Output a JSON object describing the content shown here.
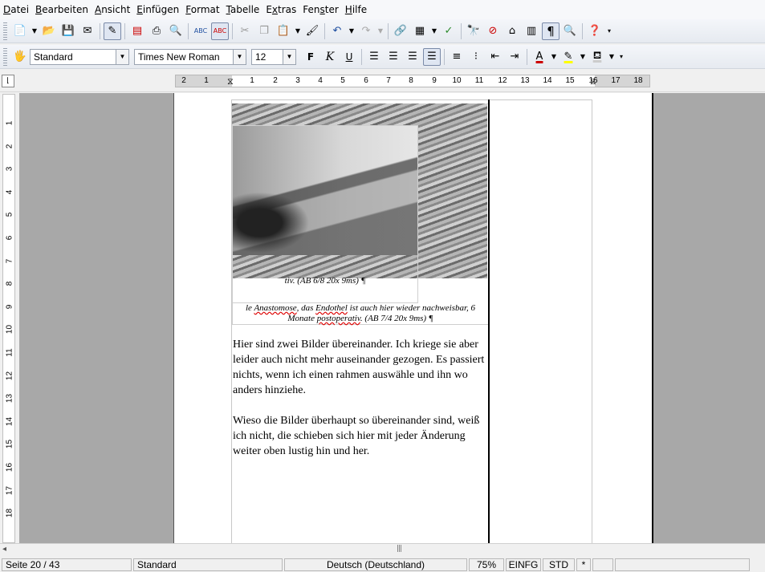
{
  "menubar": {
    "items": [
      {
        "pre": "",
        "u": "D",
        "post": "atei"
      },
      {
        "pre": "",
        "u": "B",
        "post": "earbeiten"
      },
      {
        "pre": "",
        "u": "A",
        "post": "nsicht"
      },
      {
        "pre": "",
        "u": "E",
        "post": "infügen"
      },
      {
        "pre": "",
        "u": "F",
        "post": "ormat"
      },
      {
        "pre": "",
        "u": "T",
        "post": "abelle"
      },
      {
        "pre": "E",
        "u": "x",
        "post": "tras"
      },
      {
        "pre": "Fen",
        "u": "s",
        "post": "ter"
      },
      {
        "pre": "",
        "u": "H",
        "post": "ilfe"
      }
    ]
  },
  "formatting": {
    "paragraph_style": "Standard",
    "font_name": "Times New Roman",
    "font_size": "12"
  },
  "ruler": {
    "ticks": [
      "2",
      "1",
      "1",
      "2",
      "3",
      "4",
      "5",
      "6",
      "7",
      "8",
      "9",
      "10",
      "11",
      "12",
      "13",
      "14",
      "15",
      "16",
      "17",
      "18"
    ],
    "vticks": [
      "1",
      "2",
      "3",
      "4",
      "5",
      "6",
      "7",
      "8",
      "9",
      "10",
      "11",
      "12",
      "13",
      "14",
      "15",
      "16",
      "17",
      "18"
    ]
  },
  "document": {
    "caption_inner": "tiv. (AB 6/8 20x 9ms) ¶",
    "caption_outer_a": "le ",
    "caption_outer_sp1": "Anastomose",
    "caption_outer_b": ", das ",
    "caption_outer_sp2": "Endothel",
    "caption_outer_c": " ist auch hier wieder nachweisbar, 6",
    "caption_outer_line2a": "Monate ",
    "caption_outer_sp3": "postoperativ",
    "caption_outer_line2b": ". (AB 7/4 20x 9ms) ¶",
    "paragraph1": "Hier sind zwei Bilder übereinander. Ich kriege sie aber leider auch nicht mehr auseinander gezogen. Es passiert nichts, wenn ich einen rahmen auswähle und ihn wo anders hinziehe.",
    "paragraph2": "Wieso die Bilder überhaupt so übereinander sind, weiß ich nicht, die schieben sich hier mit jeder Änderung weiter oben lustig hin und her."
  },
  "statusbar": {
    "page": "Seite 20 / 43",
    "style": "Standard",
    "language": "Deutsch (Deutschland)",
    "zoom": "75%",
    "insert_mode": "EINFG",
    "selection_mode": "STD",
    "modified": "*"
  }
}
